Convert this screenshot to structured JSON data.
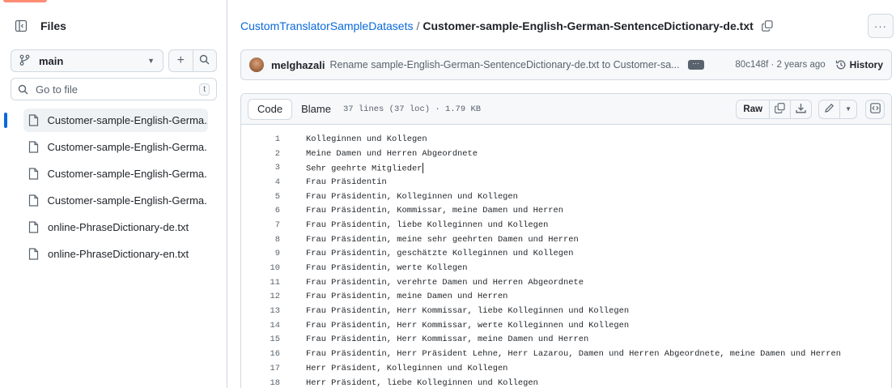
{
  "sidebar": {
    "title": "Files",
    "branch": "main",
    "goto_placeholder": "Go to file",
    "goto_shortcut": "t",
    "files": [
      {
        "name": "Customer-sample-English-Germa...",
        "active": true
      },
      {
        "name": "Customer-sample-English-Germa...",
        "active": false
      },
      {
        "name": "Customer-sample-English-Germa...",
        "active": false
      },
      {
        "name": "Customer-sample-English-Germa...",
        "active": false
      },
      {
        "name": "online-PhraseDictionary-de.txt",
        "active": false
      },
      {
        "name": "online-PhraseDictionary-en.txt",
        "active": false
      }
    ]
  },
  "breadcrumb": {
    "repo": "CustomTranslatorSampleDatasets",
    "separator": "/",
    "file": "Customer-sample-English-German-SentenceDictionary-de.txt"
  },
  "commit": {
    "author": "melghazali",
    "message": "Rename sample-English-German-SentenceDictionary-de.txt to Customer-sa...",
    "hash_age": "80c148f · 2 years ago",
    "history_label": "History"
  },
  "file_header": {
    "code_tab": "Code",
    "blame_tab": "Blame",
    "meta": "37 lines (37 loc) · 1.79 KB",
    "raw_label": "Raw"
  },
  "code_lines": [
    {
      "n": "1",
      "t": "Kolleginnen und Kollegen"
    },
    {
      "n": "2",
      "t": "Meine Damen und Herren Abgeordnete"
    },
    {
      "n": "3",
      "t": "Sehr geehrte Mitglieder"
    },
    {
      "n": "4",
      "t": "Frau Präsidentin"
    },
    {
      "n": "5",
      "t": "Frau Präsidentin, Kolleginnen und Kollegen"
    },
    {
      "n": "6",
      "t": "Frau Präsidentin, Kommissar, meine Damen und Herren"
    },
    {
      "n": "7",
      "t": "Frau Präsidentin, liebe Kolleginnen und Kollegen"
    },
    {
      "n": "8",
      "t": "Frau Präsidentin, meine sehr geehrten Damen und Herren"
    },
    {
      "n": "9",
      "t": "Frau Präsidentin, geschätzte Kolleginnen und Kollegen"
    },
    {
      "n": "10",
      "t": "Frau Präsidentin, werte Kollegen"
    },
    {
      "n": "11",
      "t": "Frau Präsidentin, verehrte Damen und Herren Abgeordnete"
    },
    {
      "n": "12",
      "t": "Frau Präsidentin, meine Damen und Herren"
    },
    {
      "n": "13",
      "t": "Frau Präsidentin, Herr Kommissar, liebe Kolleginnen und Kollegen"
    },
    {
      "n": "14",
      "t": "Frau Präsidentin, Herr Kommissar, werte Kolleginnen und Kollegen"
    },
    {
      "n": "15",
      "t": "Frau Präsidentin, Herr Kommissar, meine Damen und Herren"
    },
    {
      "n": "16",
      "t": "Frau Präsidentin, Herr Präsident Lehne, Herr Lazarou, Damen und Herren Abgeordnete, meine Damen und Herren"
    },
    {
      "n": "17",
      "t": "Herr Präsident, Kolleginnen und Kollegen"
    },
    {
      "n": "18",
      "t": "Herr Präsident, liebe Kolleginnen und Kollegen"
    }
  ],
  "colors": {
    "accent": "#0969da",
    "border": "#d1d9e0",
    "muted": "#59636e"
  }
}
